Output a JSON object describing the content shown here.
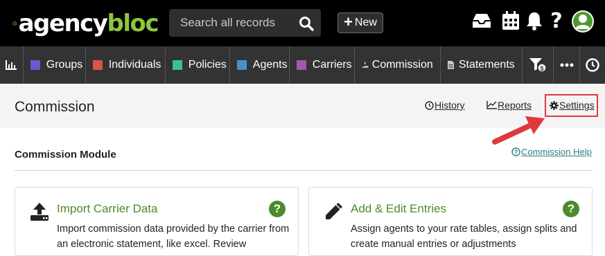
{
  "brand": {
    "logo_part1": "agency",
    "logo_part2": "bloc",
    "accent": "#8dc63f"
  },
  "search": {
    "placeholder": "Search all records"
  },
  "new_button": {
    "label": "New"
  },
  "top_icons": [
    "inbox-icon",
    "calendar-icon",
    "bell-icon",
    "help-icon",
    "user-avatar"
  ],
  "nav": {
    "items": [
      {
        "label": "Groups",
        "color": "#6a5acd"
      },
      {
        "label": "Individuals",
        "color": "#d9534f"
      },
      {
        "label": "Policies",
        "color": "#3cbf95"
      },
      {
        "label": "Agents",
        "color": "#4a90c8"
      },
      {
        "label": "Carriers",
        "color": "#a15ba8"
      },
      {
        "label": "Commission",
        "icon": "hand-coin-icon"
      },
      {
        "label": "Statements",
        "icon": "document-icon"
      }
    ],
    "icon_items": [
      "chart-icon",
      "filter-dollar-icon",
      "more-icon",
      "clock-icon"
    ]
  },
  "page": {
    "title": "Commission",
    "links": {
      "history": "History",
      "reports": "Reports",
      "settings": "Settings"
    }
  },
  "section": {
    "title": "Commission Module",
    "help": "Commission Help"
  },
  "cards": [
    {
      "title": "Import Carrier Data",
      "description": "Import commission data provided by the carrier from an electronic statement, like excel. Review",
      "icon": "upload-icon"
    },
    {
      "title": "Add & Edit Entries",
      "description": "Assign agents to your rate tables, assign splits and create manual entries or adjustments",
      "icon": "pencil-icon"
    }
  ],
  "help_symbol": "?",
  "colors": {
    "nav_bg": "#333333",
    "top_bg": "#000000",
    "card_accent": "#4d8a2a",
    "highlight": "#e0393b"
  }
}
